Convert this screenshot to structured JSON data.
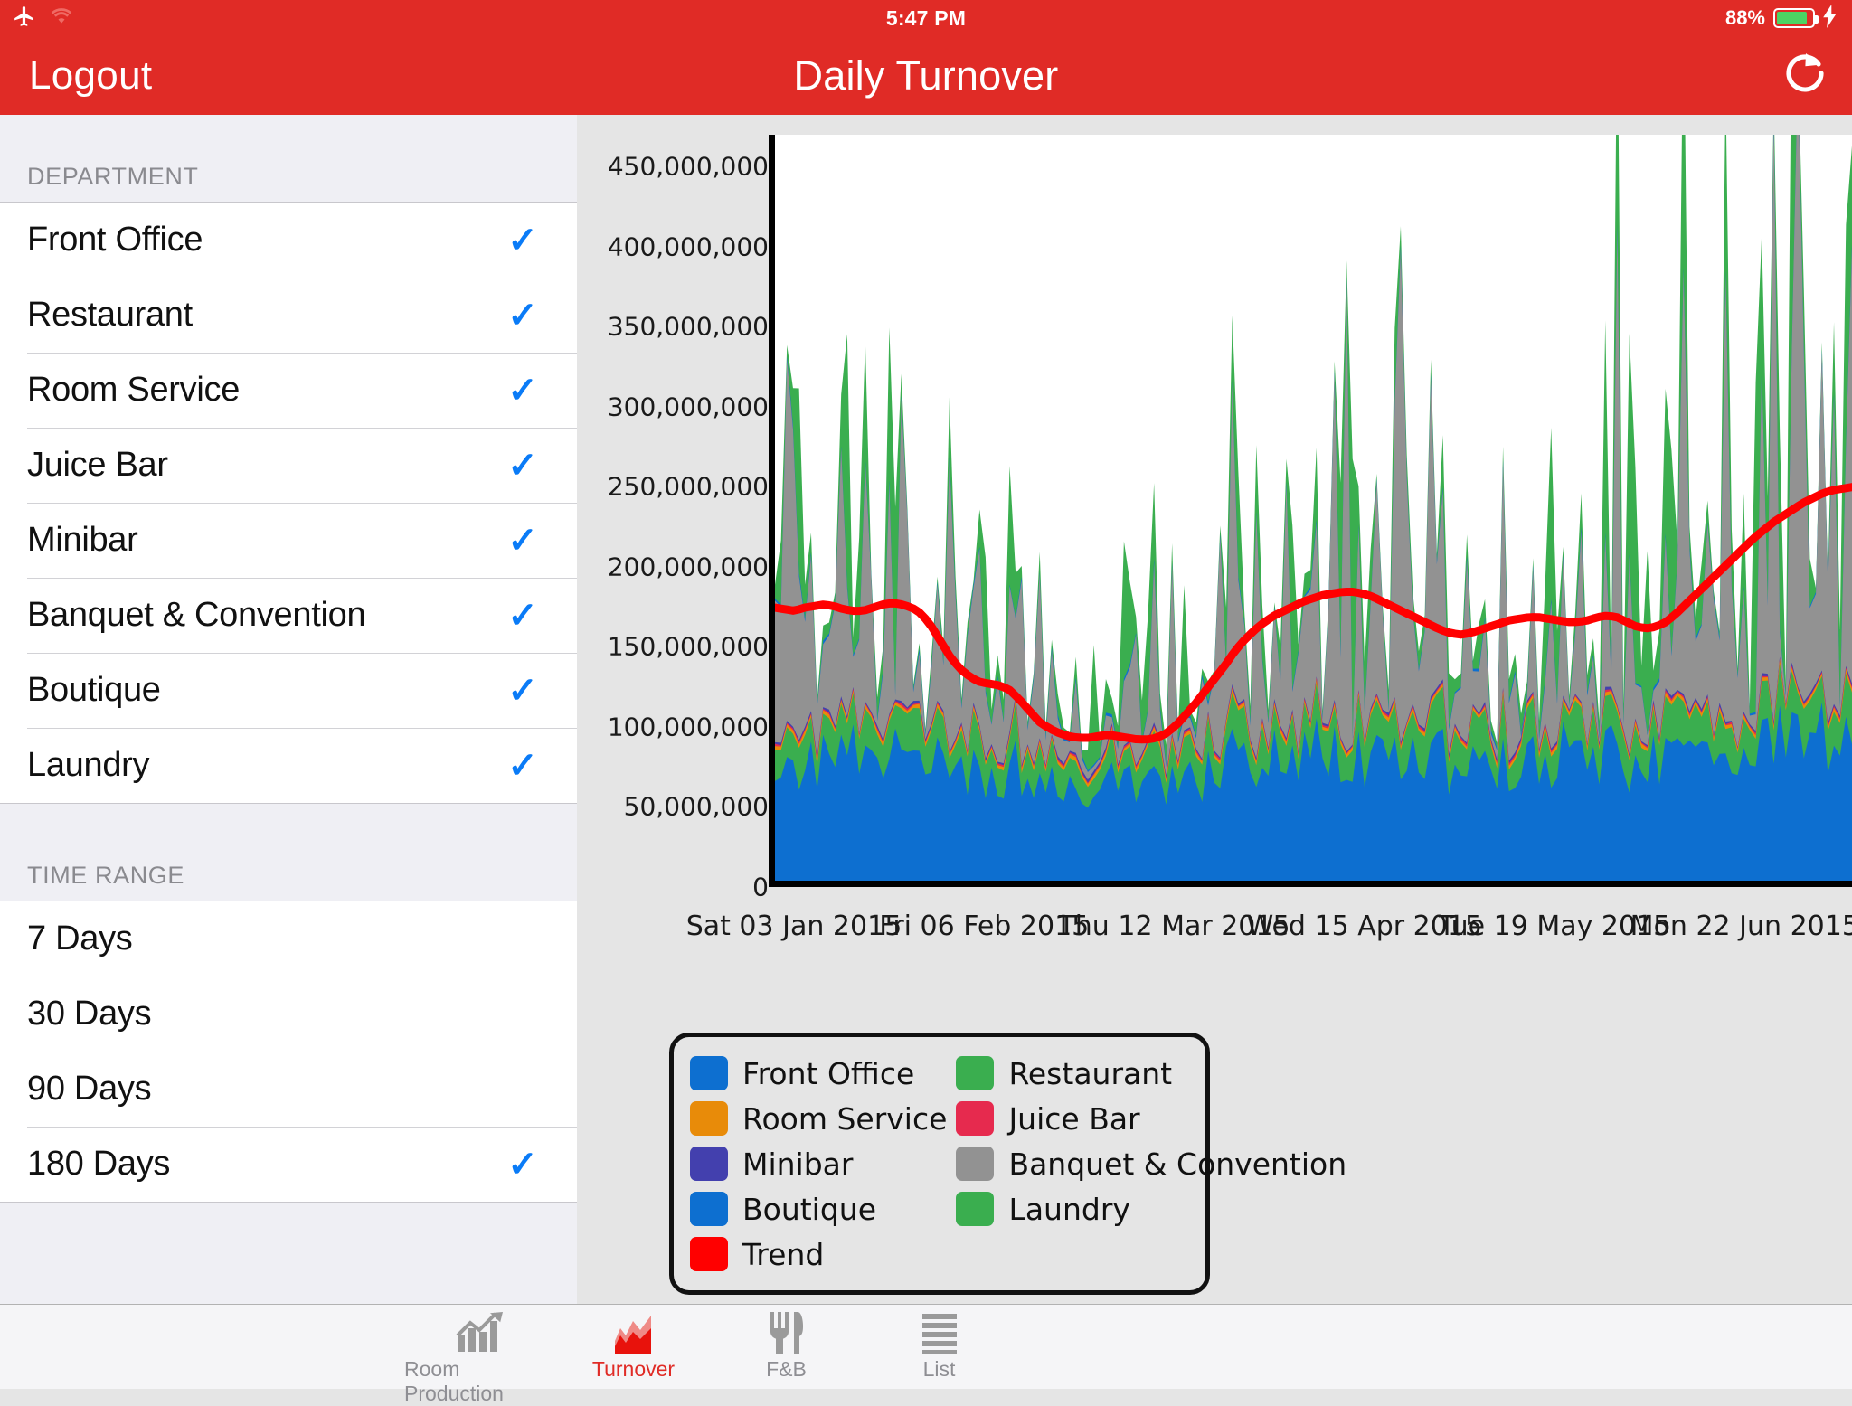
{
  "status_bar": {
    "airplane_icon": "airplane-icon",
    "wifi_icon": "wifi-icon",
    "time": "5:47 PM",
    "battery_percent": "88%",
    "battery_level": 88,
    "charging": true
  },
  "nav": {
    "logout_label": "Logout",
    "title": "Daily Turnover",
    "refresh_icon": "refresh-icon"
  },
  "sidebar": {
    "department_header": "DEPARTMENT",
    "departments": [
      {
        "label": "Front Office",
        "selected": true
      },
      {
        "label": "Restaurant",
        "selected": true
      },
      {
        "label": "Room Service",
        "selected": true
      },
      {
        "label": "Juice Bar",
        "selected": true
      },
      {
        "label": "Minibar",
        "selected": true
      },
      {
        "label": "Banquet & Convention",
        "selected": true
      },
      {
        "label": "Boutique",
        "selected": true
      },
      {
        "label": "Laundry",
        "selected": true
      }
    ],
    "time_range_header": "TIME RANGE",
    "time_ranges": [
      {
        "label": "7 Days",
        "selected": false
      },
      {
        "label": "30 Days",
        "selected": false
      },
      {
        "label": "90 Days",
        "selected": false
      },
      {
        "label": "180 Days",
        "selected": true
      }
    ],
    "checkmark_glyph": "✓"
  },
  "tabbar": {
    "tabs": [
      {
        "label": "Room Production",
        "icon": "bar-chart-arrow-icon",
        "active": false
      },
      {
        "label": "Turnover",
        "icon": "area-chart-icon",
        "active": true
      },
      {
        "label": "F&B",
        "icon": "fork-knife-icon",
        "active": false
      },
      {
        "label": "List",
        "icon": "list-lines-icon",
        "active": false
      }
    ]
  },
  "colors": {
    "brand_red": "#E02B26",
    "accent_blue": "#0A7BF7",
    "front_office": "#0D6FD0",
    "restaurant": "#3AAE4F",
    "room_service": "#E88B09",
    "juice_bar": "#E62A4E",
    "minibar": "#4340AE",
    "banquet_convention": "#929292",
    "boutique": "#0D6FD0",
    "laundry": "#3AAE4F",
    "trend": "#FF0000",
    "plot_background": "#FFFFFF",
    "content_background": "#E5E5E5",
    "sidebar_background": "#EFEFF4"
  },
  "chart_data": {
    "type": "area",
    "stacked": true,
    "title": "Daily Turnover",
    "xlabel": "",
    "ylabel": "",
    "ylim": [
      0,
      470000000
    ],
    "grid": false,
    "legend_position": "bottom-left",
    "y_ticks": [
      "0",
      "50,000,000",
      "100,000,000",
      "150,000,000",
      "200,000,000",
      "250,000,000",
      "300,000,000",
      "350,000,000",
      "400,000,000",
      "450,000,000"
    ],
    "y_tick_values": [
      0,
      50000000,
      100000000,
      150000000,
      200000000,
      250000000,
      300000000,
      350000000,
      400000000,
      450000000
    ],
    "x_tick_labels": [
      "Sat 03 Jan 2015",
      "Fri 06 Feb 2015",
      "Thu 12 Mar 2015",
      "Wed 15 Apr 2015",
      "Tue 19 May 2015",
      "Mon 22 Jun 2015"
    ],
    "x_range": "Sat 03 Jan 2015 to Mon 22 Jun 2015",
    "point_count": 180,
    "series": [
      {
        "name": "Front Office",
        "color": "#0D6FD0",
        "mean": 62000000
      },
      {
        "name": "Restaurant",
        "color": "#3AAE4F",
        "mean": 16000000
      },
      {
        "name": "Room Service",
        "color": "#E88B09",
        "mean": 2500000
      },
      {
        "name": "Juice Bar",
        "color": "#E62A4E",
        "mean": 1200000
      },
      {
        "name": "Minibar",
        "color": "#4340AE",
        "mean": 1500000
      },
      {
        "name": "Banquet & Convention",
        "color": "#929292",
        "mean": 75000000
      },
      {
        "name": "Boutique",
        "color": "#0D6FD0",
        "mean": 2000000
      },
      {
        "name": "Laundry",
        "color": "#3AAE4F",
        "mean": 30000000
      },
      {
        "name": "Trend",
        "color": "#FF0000",
        "type": "line",
        "start": 172000000,
        "min": 88000000,
        "end": 248000000
      }
    ],
    "legend_entries": [
      {
        "label": "Front Office",
        "color": "#0D6FD0"
      },
      {
        "label": "Restaurant",
        "color": "#3AAE4F"
      },
      {
        "label": "Room Service",
        "color": "#E88B09"
      },
      {
        "label": "Juice Bar",
        "color": "#E62A4E"
      },
      {
        "label": "Minibar",
        "color": "#4340AE"
      },
      {
        "label": "Banquet & Convention",
        "color": "#929292"
      },
      {
        "label": "Boutique",
        "color": "#0D6FD0"
      },
      {
        "label": "Laundry",
        "color": "#3AAE4F"
      },
      {
        "label": "Trend",
        "color": "#FF0000"
      }
    ],
    "trend_values": [
      172,
      171,
      170,
      172,
      173,
      174,
      173,
      171,
      170,
      170,
      172,
      174,
      175,
      174,
      172,
      168,
      160,
      150,
      140,
      133,
      128,
      125,
      124,
      123,
      120,
      114,
      107,
      100,
      96,
      93,
      91,
      90,
      90,
      91,
      92,
      91,
      90,
      89,
      89,
      90,
      93,
      98,
      105,
      112,
      120,
      128,
      136,
      145,
      152,
      158,
      163,
      167,
      170,
      173,
      176,
      178,
      180,
      181,
      182,
      182,
      181,
      179,
      176,
      173,
      170,
      167,
      164,
      161,
      158,
      156,
      155,
      156,
      158,
      160,
      162,
      164,
      165,
      166,
      166,
      165,
      164,
      163,
      163,
      164,
      166,
      167,
      166,
      163,
      160,
      159,
      160,
      163,
      168,
      174,
      180,
      186,
      192,
      198,
      204,
      210,
      216,
      221,
      226,
      230,
      234,
      238,
      241,
      244,
      246,
      247,
      248
    ],
    "trend_unit": "millions"
  }
}
